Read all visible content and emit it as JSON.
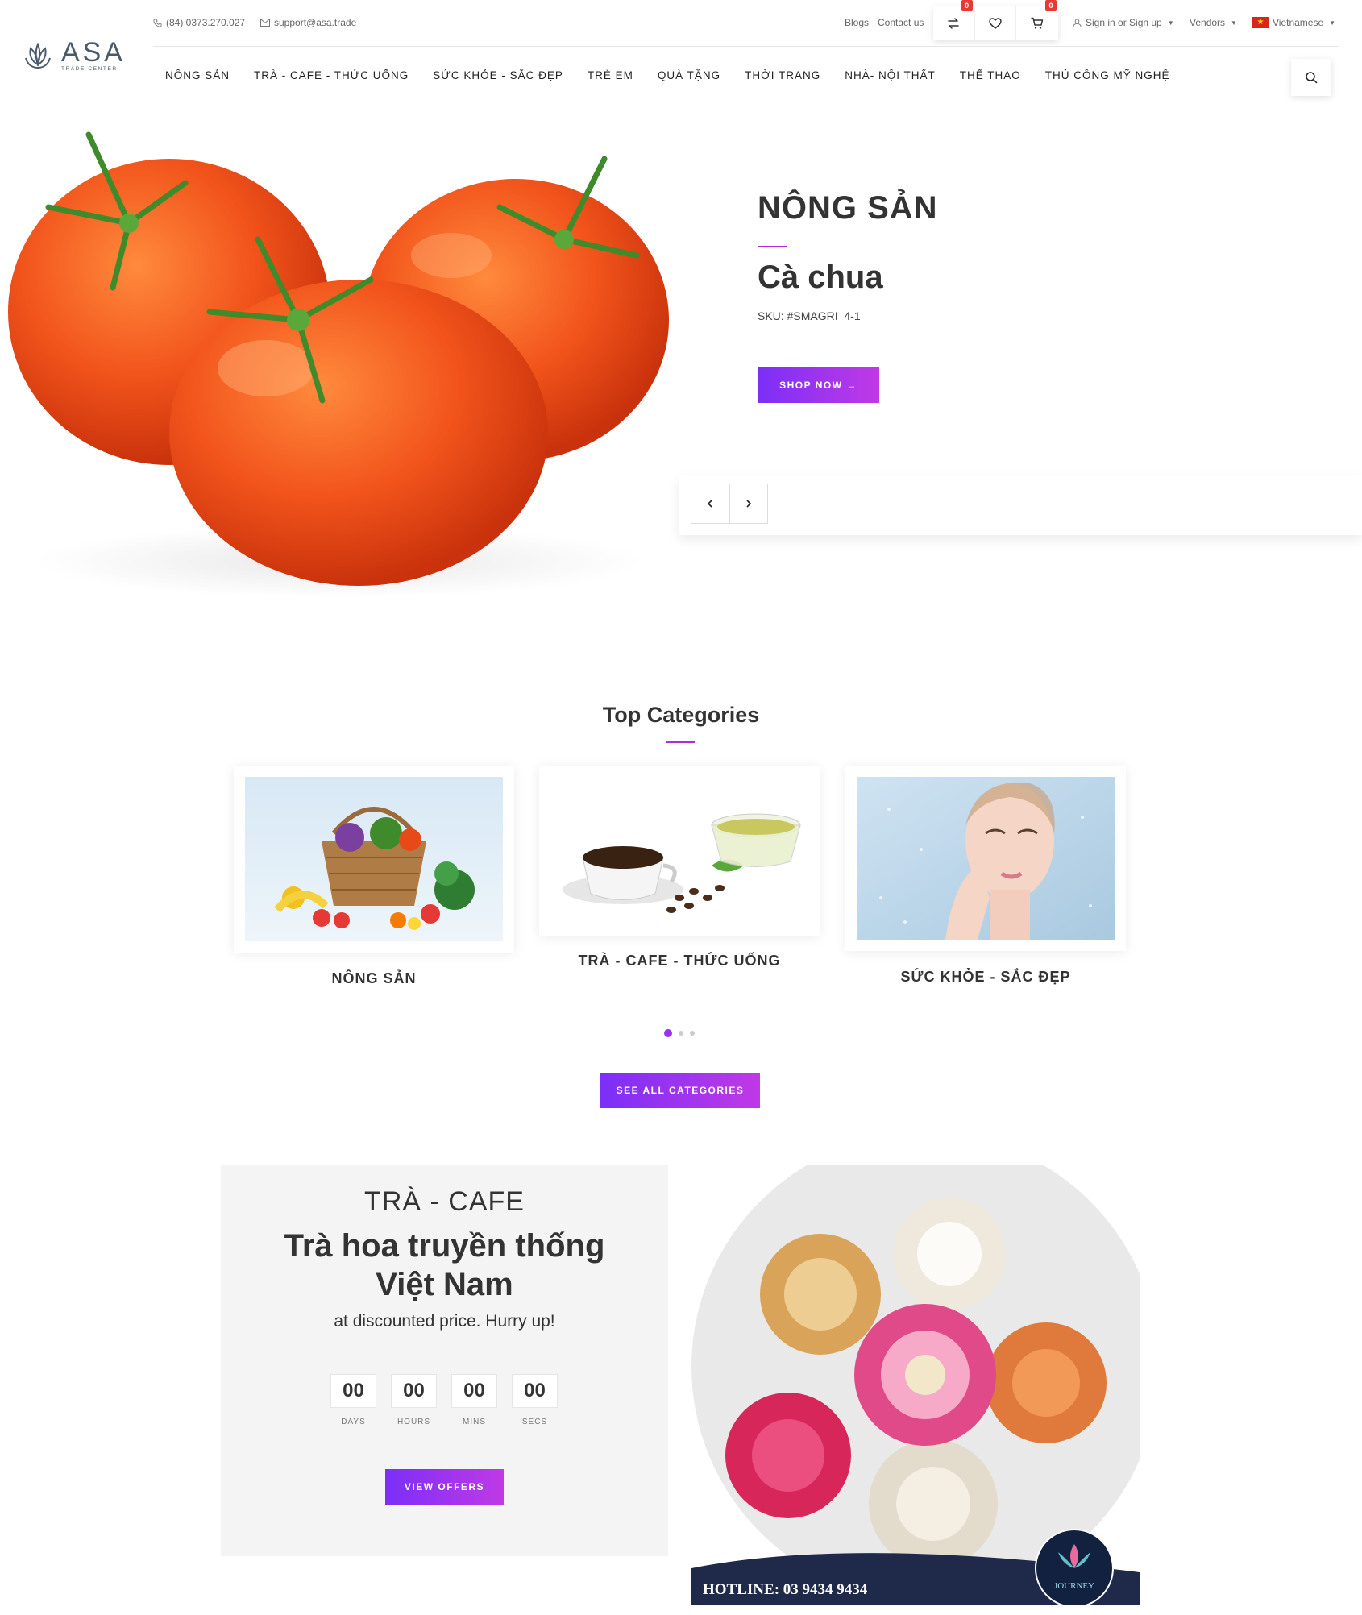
{
  "brand": {
    "name": "ASA",
    "tagline": "TRADE CENTER"
  },
  "topbar": {
    "phone": "(84) 0373.270.027",
    "email": "support@asa.trade",
    "blogs": "Blogs",
    "contact": "Contact us",
    "compare_count": "0",
    "cart_count": "0",
    "account": "Sign in or Sign up",
    "vendors": "Vendors",
    "language": "Vietnamese"
  },
  "nav": {
    "items": [
      "NÔNG SẢN",
      "TRÀ - CAFE - THỨC UỐNG",
      "SỨC KHỎE - SẮC ĐẸP",
      "TRẺ EM",
      "QUÀ TẶNG",
      "THỜI TRANG",
      "NHÀ- NỘI THẤT",
      "THỂ THAO",
      "THỦ CÔNG MỸ NGHỆ"
    ]
  },
  "hero": {
    "category": "NÔNG SẢN",
    "product": "Cà chua",
    "sku": "SKU: #SMAGRI_4-1",
    "cta": "SHOP NOW →"
  },
  "categories": {
    "title": "Top Categories",
    "items": [
      "NÔNG SẢN",
      "TRÀ - CAFE - THỨC UỐNG",
      "SỨC KHỎE - SẮC ĐẸP"
    ],
    "cta": "SEE ALL CATEGORIES"
  },
  "deal": {
    "kicker": "TRÀ - CAFE",
    "title_line1": "Trà hoa truyền thống",
    "title_line2": "Việt Nam",
    "desc": "at discounted price. Hurry up!",
    "countdown": [
      {
        "value": "00",
        "label": "DAYS"
      },
      {
        "value": "00",
        "label": "HOURS"
      },
      {
        "value": "00",
        "label": "MINS"
      },
      {
        "value": "00",
        "label": "SECS"
      }
    ],
    "cta": "VIEW OFFERS",
    "image_caption": "HOTLINE: 03 9434 9434",
    "image_logo_text": "JOURNEY"
  },
  "colors": {
    "accent": "#9c2ff0",
    "accent2": "#c039e6",
    "text": "#333333"
  }
}
